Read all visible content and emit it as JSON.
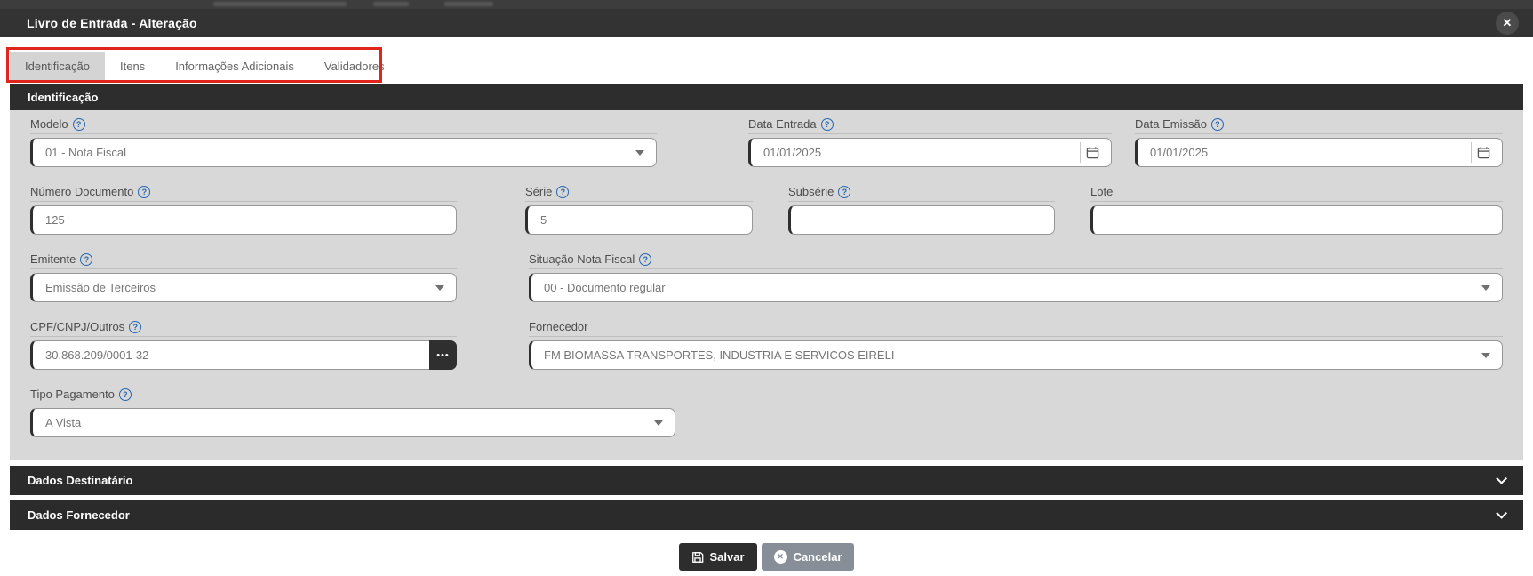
{
  "modal": {
    "title": "Livro de Entrada - Alteração",
    "close_label": "✕"
  },
  "tabs": [
    {
      "label": "Identificação",
      "active": true
    },
    {
      "label": "Itens",
      "active": false
    },
    {
      "label": "Informações Adicionais",
      "active": false
    },
    {
      "label": "Validadores",
      "active": false
    }
  ],
  "sections": {
    "identificacao": "Identificação"
  },
  "fields": {
    "modelo": {
      "label": "Modelo",
      "value": "01 - Nota Fiscal"
    },
    "data_entrada": {
      "label": "Data Entrada",
      "value": "01/01/2025"
    },
    "data_emissao": {
      "label": "Data Emissão",
      "value": "01/01/2025"
    },
    "numero_documento": {
      "label": "Número Documento",
      "value": "125"
    },
    "serie": {
      "label": "Série",
      "value": "5"
    },
    "subserie": {
      "label": "Subsérie",
      "value": ""
    },
    "lote": {
      "label": "Lote",
      "value": ""
    },
    "emitente": {
      "label": "Emitente",
      "value": "Emissão de Terceiros"
    },
    "situacao": {
      "label": "Situação Nota Fiscal",
      "value": "00 - Documento regular"
    },
    "cpf_cnpj": {
      "label": "CPF/CNPJ/Outros",
      "value": "30.868.209/0001-32",
      "button_label": "•••"
    },
    "fornecedor": {
      "label": "Fornecedor",
      "value": "FM BIOMASSA TRANSPORTES, INDUSTRIA E SERVICOS EIRELI"
    },
    "tipo_pagamento": {
      "label": "Tipo Pagamento",
      "value": "A Vista"
    }
  },
  "help_icon_glyph": "?",
  "accordions": [
    {
      "label": "Dados Destinatário"
    },
    {
      "label": "Dados Fornecedor"
    }
  ],
  "footer": {
    "save_label": "Salvar",
    "cancel_label": "Cancelar"
  },
  "colors": {
    "annotation_red": "#e0261c",
    "dark_bar": "#2d2d2d",
    "form_background": "#d8d8d8",
    "help_blue": "#2867b0",
    "cancel_gray": "#878e97"
  }
}
